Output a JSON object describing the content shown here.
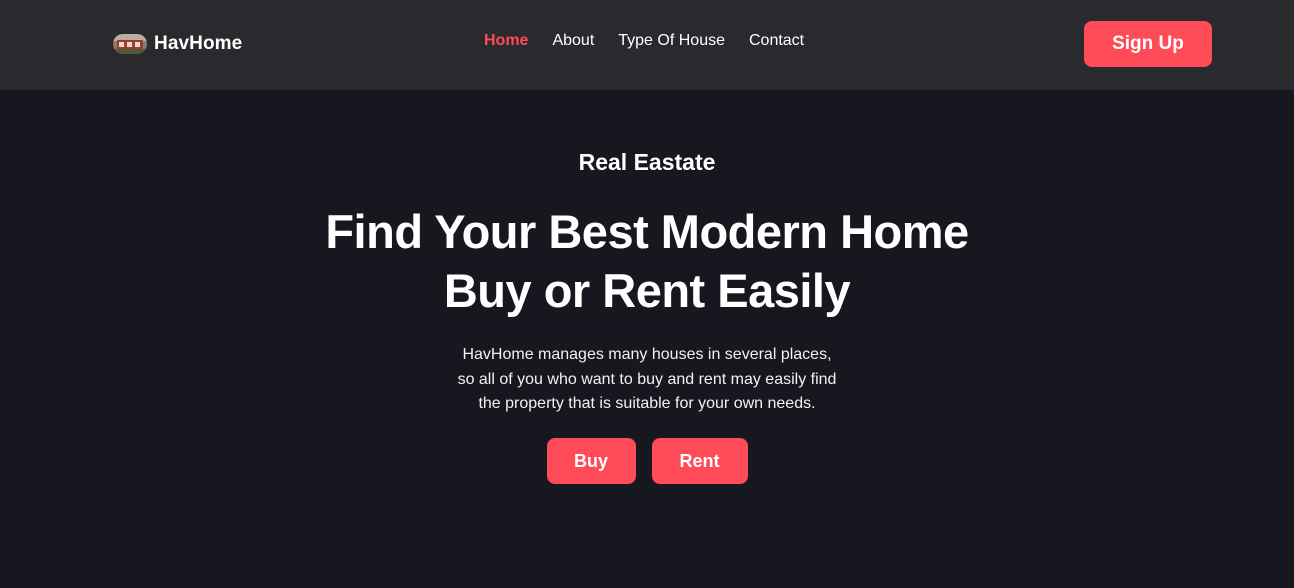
{
  "nav": {
    "brand": "HavHome",
    "logo_icon": "house-photo-logo",
    "links": [
      {
        "label": "Home",
        "active": true
      },
      {
        "label": "About",
        "active": false
      },
      {
        "label": "Type Of House",
        "active": false
      },
      {
        "label": "Contact",
        "active": false
      }
    ],
    "signup_label": "Sign Up"
  },
  "hero": {
    "eyebrow": "Real Eastate",
    "headline": [
      "Find Your Best Modern Home",
      "Buy or Rent Easily"
    ],
    "description": [
      "HavHome manages many houses in several places,",
      "so all of you who want to buy and rent may easily find",
      "the property that is suitable for your own needs."
    ],
    "buttons": {
      "buy": "Buy",
      "rent": "Rent"
    }
  },
  "colors": {
    "accent": "#ff4a57",
    "navbar_bg": "#2a2a2e",
    "page_bg": "#171720",
    "text": "#ffffff"
  }
}
